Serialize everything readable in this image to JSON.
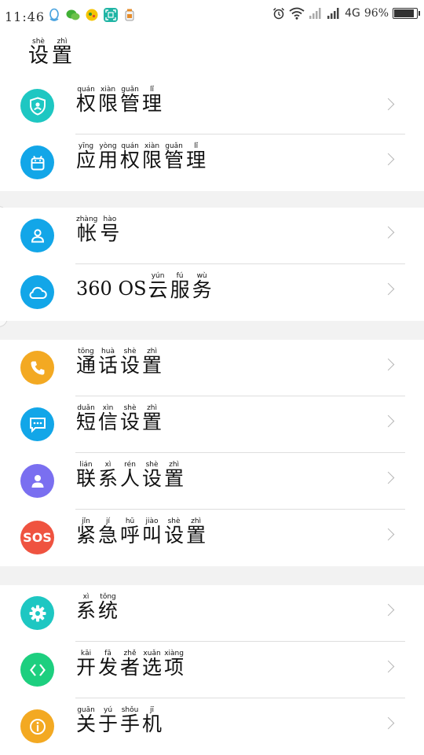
{
  "status_bar": {
    "time": "11:46",
    "network": "4G",
    "battery_pct_text": "96%",
    "battery_level": 0.96,
    "app_icons": [
      {
        "icon": "qq-icon",
        "color": "#4aa3df"
      },
      {
        "icon": "wechat-icon",
        "color": "#41b035"
      },
      {
        "icon": "game-icon",
        "color": "#e8b400"
      },
      {
        "icon": "scanner-icon",
        "color": "#21b5a5"
      },
      {
        "icon": "cleaner-icon",
        "color": "#e58c2a"
      }
    ]
  },
  "header": {
    "title": [
      {
        "hz": "设",
        "py": "shè"
      },
      {
        "hz": "置",
        "py": "zhì"
      }
    ]
  },
  "groups": [
    {
      "items": [
        {
          "id": "permission",
          "icon": "shield-user-icon",
          "color": "#1ec7c2",
          "label": [
            {
              "hz": "权",
              "py": "quán"
            },
            {
              "hz": "限",
              "py": "xiàn"
            },
            {
              "hz": "管",
              "py": "guǎn"
            },
            {
              "hz": "理",
              "py": "lǐ"
            }
          ]
        },
        {
          "id": "app-permission",
          "icon": "android-icon",
          "color": "#12a6e8",
          "label": [
            {
              "hz": "应",
              "py": "yīng"
            },
            {
              "hz": "用",
              "py": "yòng"
            },
            {
              "hz": "权",
              "py": "quán"
            },
            {
              "hz": "限",
              "py": "xiàn"
            },
            {
              "hz": "管",
              "py": "guǎn"
            },
            {
              "hz": "理",
              "py": "lǐ"
            }
          ]
        }
      ]
    },
    {
      "items": [
        {
          "id": "account",
          "icon": "user-icon",
          "color": "#12a6e8",
          "label": [
            {
              "hz": "帐",
              "py": "zhàng"
            },
            {
              "hz": "号",
              "py": "hào"
            }
          ]
        },
        {
          "id": "cloud",
          "icon": "cloud-icon",
          "color": "#12a6e8",
          "prefix": "360 OS",
          "label": [
            {
              "hz": "云",
              "py": "yún"
            },
            {
              "hz": "服",
              "py": "fú"
            },
            {
              "hz": "务",
              "py": "wù"
            }
          ]
        }
      ]
    },
    {
      "items": [
        {
          "id": "call",
          "icon": "phone-icon",
          "color": "#f3a922",
          "label": [
            {
              "hz": "通",
              "py": "tōng"
            },
            {
              "hz": "话",
              "py": "huà"
            },
            {
              "hz": "设",
              "py": "shè"
            },
            {
              "hz": "置",
              "py": "zhì"
            }
          ]
        },
        {
          "id": "sms",
          "icon": "message-icon",
          "color": "#12a6e8",
          "label": [
            {
              "hz": "短",
              "py": "duǎn"
            },
            {
              "hz": "信",
              "py": "xìn"
            },
            {
              "hz": "设",
              "py": "shè"
            },
            {
              "hz": "置",
              "py": "zhì"
            }
          ]
        },
        {
          "id": "contacts",
          "icon": "contact-icon",
          "color": "#7a6ff0",
          "label": [
            {
              "hz": "联",
              "py": "lián"
            },
            {
              "hz": "系",
              "py": "xì"
            },
            {
              "hz": "人",
              "py": "rén"
            },
            {
              "hz": "设",
              "py": "shè"
            },
            {
              "hz": "置",
              "py": "zhì"
            }
          ]
        },
        {
          "id": "sos",
          "icon": "sos-icon",
          "color": "#ef5340",
          "icon_text": "SOS",
          "label": [
            {
              "hz": "紧",
              "py": "jǐn"
            },
            {
              "hz": "急",
              "py": "jí"
            },
            {
              "hz": "呼",
              "py": "hū"
            },
            {
              "hz": "叫",
              "py": "jiào"
            },
            {
              "hz": "设",
              "py": "shè"
            },
            {
              "hz": "置",
              "py": "zhì"
            }
          ]
        }
      ]
    },
    {
      "items": [
        {
          "id": "system",
          "icon": "gear-icon",
          "color": "#1ec7c2",
          "label": [
            {
              "hz": "系",
              "py": "xì"
            },
            {
              "hz": "统",
              "py": "tǒng"
            }
          ]
        },
        {
          "id": "developer",
          "icon": "code-icon",
          "color": "#1dcf7f",
          "label": [
            {
              "hz": "开",
              "py": "kāi"
            },
            {
              "hz": "发",
              "py": "fā"
            },
            {
              "hz": "者",
              "py": "zhě"
            },
            {
              "hz": "选",
              "py": "xuǎn"
            },
            {
              "hz": "项",
              "py": "xiàng"
            }
          ]
        },
        {
          "id": "about",
          "icon": "info-icon",
          "color": "#f3a922",
          "label": [
            {
              "hz": "关",
              "py": "guān"
            },
            {
              "hz": "于",
              "py": "yú"
            },
            {
              "hz": "手",
              "py": "shǒu"
            },
            {
              "hz": "机",
              "py": "jī"
            }
          ]
        }
      ]
    }
  ]
}
